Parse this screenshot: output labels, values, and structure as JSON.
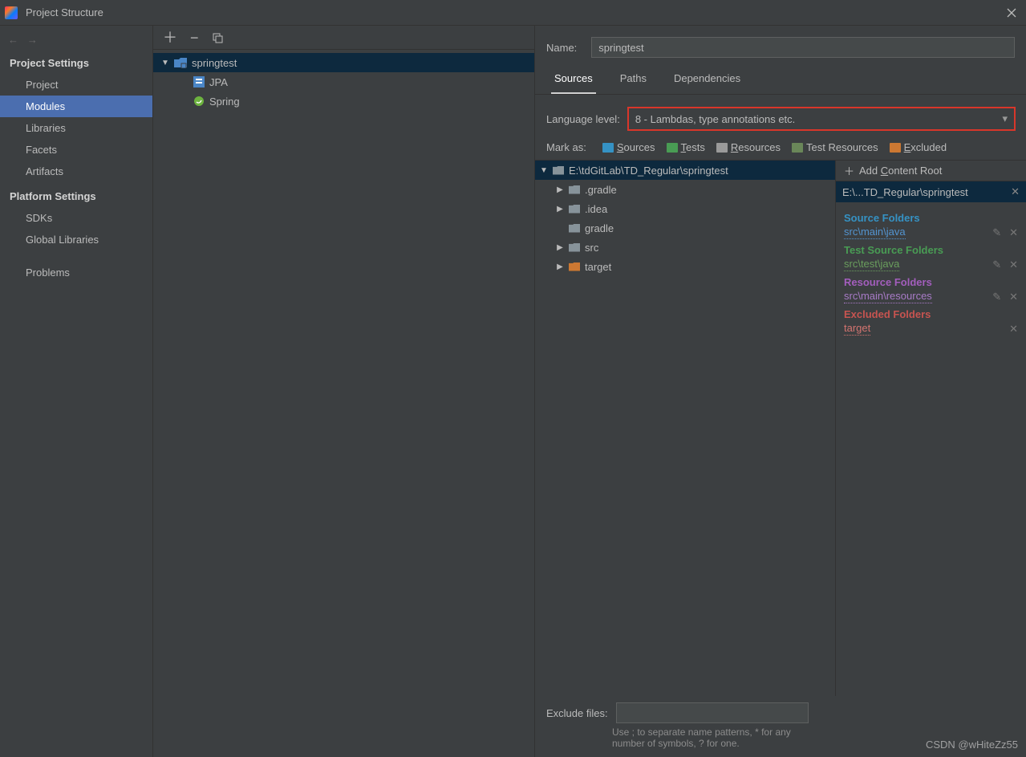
{
  "title": "Project Structure",
  "left": {
    "projectSettings": "Project Settings",
    "platformSettings": "Platform Settings",
    "items": {
      "project": "Project",
      "modules": "Modules",
      "libraries": "Libraries",
      "facets": "Facets",
      "artifacts": "Artifacts",
      "sdks": "SDKs",
      "globalLibraries": "Global Libraries",
      "problems": "Problems"
    }
  },
  "middle": {
    "module": "springtest",
    "children": {
      "jpa": "JPA",
      "spring": "Spring"
    }
  },
  "right": {
    "nameLabel": "Name:",
    "name": "springtest",
    "tabs": {
      "sources": "Sources",
      "paths": "Paths",
      "deps": "Dependencies"
    },
    "langLabel": "Language level:",
    "langValue": "8 - Lambdas, type annotations etc.",
    "markAs": "Mark as:",
    "marks": {
      "sources": "Sources",
      "tests": "Tests",
      "resources": "Resources",
      "testRes": "Test Resources",
      "excluded": "Excluded"
    },
    "rootPath": "E:\\tdGitLab\\TD_Regular\\springtest",
    "folders": {
      "gradleDot": ".gradle",
      "ideaDot": ".idea",
      "gradle": "gradle",
      "src": "src",
      "target": "target"
    },
    "addContent": "Add Content Root",
    "contentRootShort": "E:\\...TD_Regular\\springtest",
    "groups": {
      "source": "Source Folders",
      "sourceItem": "src\\main\\java",
      "test": "Test Source Folders",
      "testItem": "src\\test\\java",
      "resource": "Resource Folders",
      "resourceItem": "src\\main\\resources",
      "excluded": "Excluded Folders",
      "excludedItem": "target"
    },
    "excludeLabel": "Exclude files:",
    "hint": "Use ; to separate name patterns, * for any number of symbols, ? for one."
  },
  "watermark": "CSDN @wHiteZz55"
}
